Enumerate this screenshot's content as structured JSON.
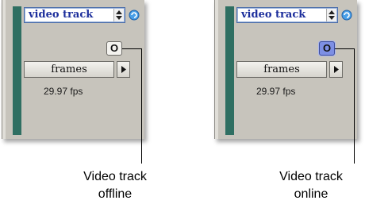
{
  "panels": [
    {
      "track_name": "video track",
      "online_button_label": "O",
      "online_state": "offline",
      "timecode_format": "frames",
      "frame_rate": "29.97 fps",
      "caption": [
        "Video track",
        "offline"
      ]
    },
    {
      "track_name": "video track",
      "online_button_label": "O",
      "online_state": "online",
      "timecode_format": "frames",
      "frame_rate": "29.97 fps",
      "caption": [
        "Video track",
        "online"
      ]
    }
  ],
  "colors": {
    "panel_bg": "#c7c4bc",
    "track_strip": "#2f6f62",
    "track_name_text": "#1d2f9c",
    "online_active": "#7d8fe4"
  },
  "icons": {
    "stepper": "up-down-stepper-icon",
    "globe": "globe-icon",
    "menu_arrow": "right-triangle-icon"
  }
}
